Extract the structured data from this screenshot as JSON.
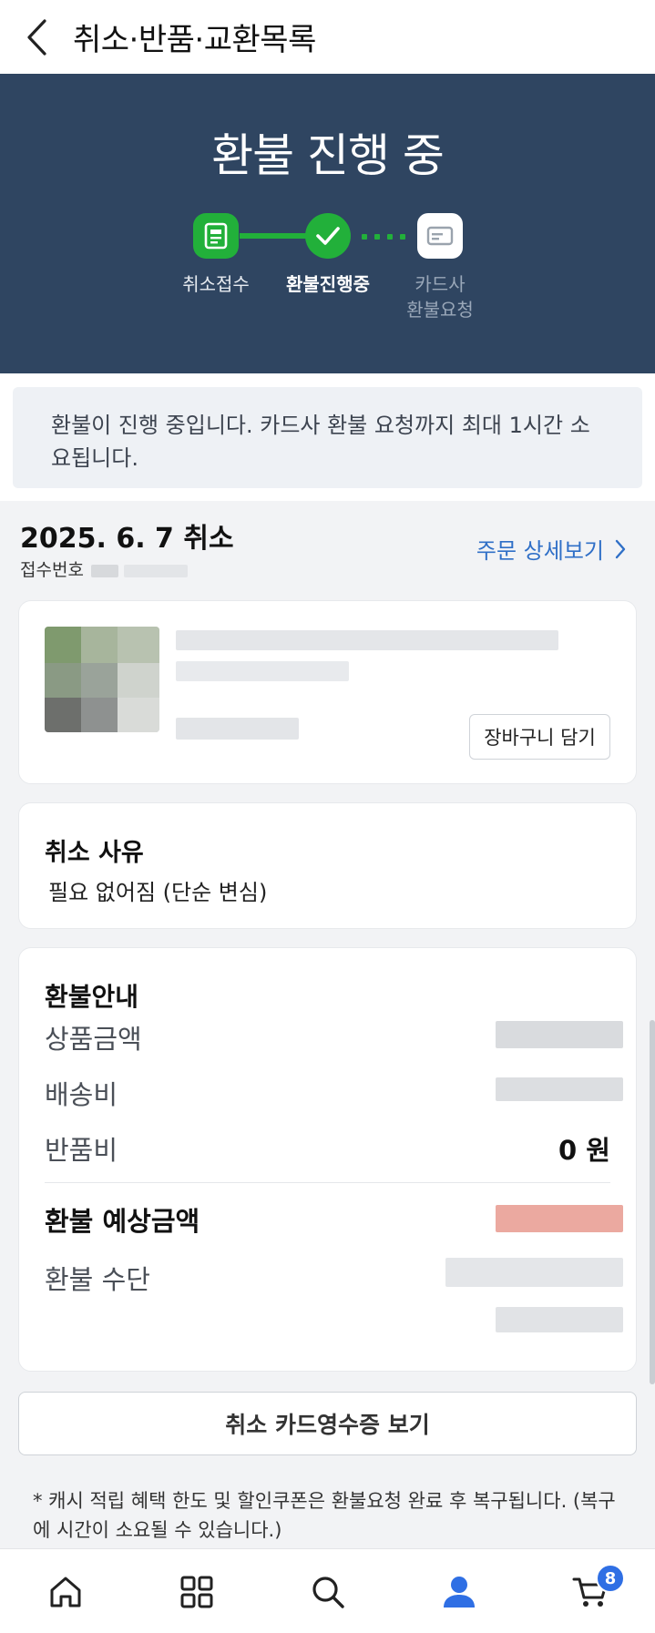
{
  "header": {
    "title": "취소·반품·교환목록",
    "back_icon": "chevron-left-icon"
  },
  "status": {
    "title": "환불 진행 중",
    "steps": [
      {
        "label": "취소접수",
        "state": "done",
        "icon": "document-icon"
      },
      {
        "label": "환불진행중",
        "state": "current",
        "icon": "check-icon"
      },
      {
        "label_line1": "카드사",
        "label_line2": "환불요청",
        "state": "pending",
        "icon": "card-icon"
      }
    ],
    "colors": {
      "panel": "#2f4561",
      "active": "#22b03a",
      "pending": "#ffffff"
    }
  },
  "notice": {
    "text": "환불이 진행 중입니다. 카드사 환불 요청까지 최대 1시간 소요됩니다."
  },
  "order": {
    "date_label": "2025. 6. 7 취소",
    "number_prefix": "접수번호",
    "detail_link": "주문 상세보기"
  },
  "product": {
    "cart_button": "장바구니 담기"
  },
  "reason": {
    "title": "취소 사유",
    "text": "필요 없어짐 (단순 변심)"
  },
  "refund": {
    "title": "환불안내",
    "rows": [
      {
        "label": "상품금액",
        "value": ""
      },
      {
        "label": "배송비",
        "value": ""
      },
      {
        "label": "반품비",
        "value": "0 원"
      }
    ],
    "expected_label": "환불 예상금액",
    "method_label": "환불 수단"
  },
  "receipt_button": "취소 카드영수증 보기",
  "footnote": "* 캐시 적립 혜택 한도 및 할인쿠폰은 환불요청 완료 후 복구됩니다. (복구에 시간이 소요될 수 있습니다.)",
  "bottom_nav": {
    "items": [
      "home-icon",
      "grid-icon",
      "search-icon",
      "user-icon",
      "cart-icon"
    ],
    "cart_badge": "8",
    "active": "user-icon",
    "accent_color": "#2f6fe4"
  }
}
